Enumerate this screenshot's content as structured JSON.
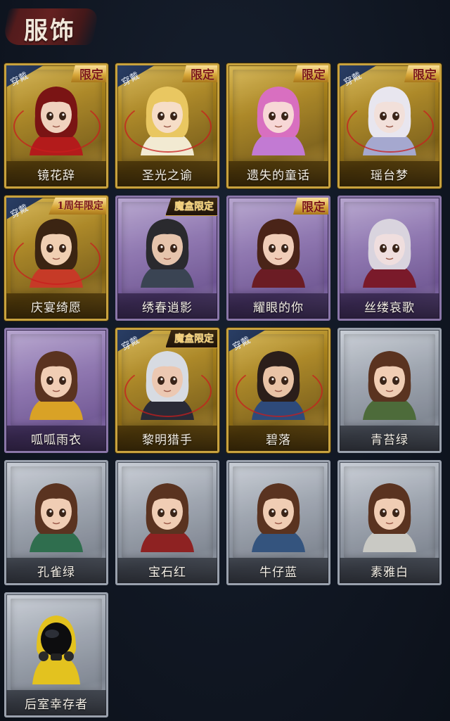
{
  "section": {
    "title": "服饰"
  },
  "costumes": [
    {
      "name": "镜花辞",
      "rarity": "gold",
      "worn": true,
      "tag": "限定",
      "tag_style": "limited",
      "palette": {
        "hair": "#7a1414",
        "skin": "#f0d2be",
        "cloth": "#b31b1b"
      }
    },
    {
      "name": "圣光之谕",
      "rarity": "gold",
      "worn": true,
      "tag": "限定",
      "tag_style": "limited",
      "palette": {
        "hair": "#e9c761",
        "skin": "#f6ddc7",
        "cloth": "#f2ead2"
      }
    },
    {
      "name": "遗失的童话",
      "rarity": "gold",
      "worn": false,
      "tag": "限定",
      "tag_style": "limited",
      "palette": {
        "hair": "#d86fc0",
        "skin": "#f7d7d6",
        "cloth": "#c27ad3"
      }
    },
    {
      "name": "瑶台梦",
      "rarity": "gold",
      "worn": true,
      "tag": "限定",
      "tag_style": "limited",
      "palette": {
        "hair": "#e8e6ef",
        "skin": "#f2e0da",
        "cloth": "#a5a8cf"
      }
    },
    {
      "name": "庆宴绮愿",
      "rarity": "gold",
      "worn": true,
      "tag": "1周年限定",
      "tag_style": "anniv",
      "palette": {
        "hair": "#3b2412",
        "skin": "#f0cfb2",
        "cloth": "#c63a27"
      }
    },
    {
      "name": "绣春逍影",
      "rarity": "purple",
      "worn": false,
      "tag": "魔盒限定",
      "tag_style": "box",
      "palette": {
        "hair": "#2a2a2e",
        "skin": "#e6c4ac",
        "cloth": "#3a4453"
      }
    },
    {
      "name": "耀眼的你",
      "rarity": "purple",
      "worn": false,
      "tag": "限定",
      "tag_style": "limited",
      "palette": {
        "hair": "#4a2418",
        "skin": "#f0cdb8",
        "cloth": "#6b1c24"
      }
    },
    {
      "name": "丝缕哀歌",
      "rarity": "purple",
      "worn": false,
      "tag": "",
      "tag_style": "",
      "palette": {
        "hair": "#d9d4de",
        "skin": "#efdede",
        "cloth": "#7a1a2a"
      }
    },
    {
      "name": "呱呱雨衣",
      "rarity": "purple",
      "worn": false,
      "tag": "",
      "tag_style": "",
      "palette": {
        "hair": "#5a3320",
        "skin": "#f0cdb4",
        "cloth": "#d9a226"
      }
    },
    {
      "name": "黎明猎手",
      "rarity": "gold",
      "worn": true,
      "tag": "魔盒限定",
      "tag_style": "box",
      "palette": {
        "hair": "#d7dbe2",
        "skin": "#ecc8b2",
        "cloth": "#2a2a36"
      }
    },
    {
      "name": "碧落",
      "rarity": "gold",
      "worn": true,
      "tag": "",
      "tag_style": "",
      "palette": {
        "hair": "#2b1e1a",
        "skin": "#e9c3a6",
        "cloth": "#2e4a7a"
      }
    },
    {
      "name": "青苔绿",
      "rarity": "gray",
      "worn": false,
      "tag": "",
      "tag_style": "",
      "palette": {
        "hair": "#5a3320",
        "skin": "#f0cdb4",
        "cloth": "#4d6b3a"
      }
    },
    {
      "name": "孔雀绿",
      "rarity": "gray",
      "worn": false,
      "tag": "",
      "tag_style": "",
      "palette": {
        "hair": "#5a3320",
        "skin": "#f0cdb4",
        "cloth": "#2f6e4e"
      }
    },
    {
      "name": "宝石红",
      "rarity": "gray",
      "worn": false,
      "tag": "",
      "tag_style": "",
      "palette": {
        "hair": "#5a3320",
        "skin": "#f0cdb4",
        "cloth": "#8e2222"
      }
    },
    {
      "name": "牛仔蓝",
      "rarity": "gray",
      "worn": false,
      "tag": "",
      "tag_style": "",
      "palette": {
        "hair": "#5a3320",
        "skin": "#f0cdb4",
        "cloth": "#34547e"
      }
    },
    {
      "name": "素雅白",
      "rarity": "gray",
      "worn": false,
      "tag": "",
      "tag_style": "",
      "palette": {
        "hair": "#5a3320",
        "skin": "#f0cdb4",
        "cloth": "#c9c9c4"
      }
    },
    {
      "name": "后室幸存者",
      "rarity": "gray",
      "worn": false,
      "tag": "",
      "tag_style": "",
      "palette": {
        "hair": "#151515",
        "skin": "#1a1a1a",
        "cloth": "#e3c21f"
      }
    }
  ],
  "labels": {
    "worn": "穿戴"
  }
}
